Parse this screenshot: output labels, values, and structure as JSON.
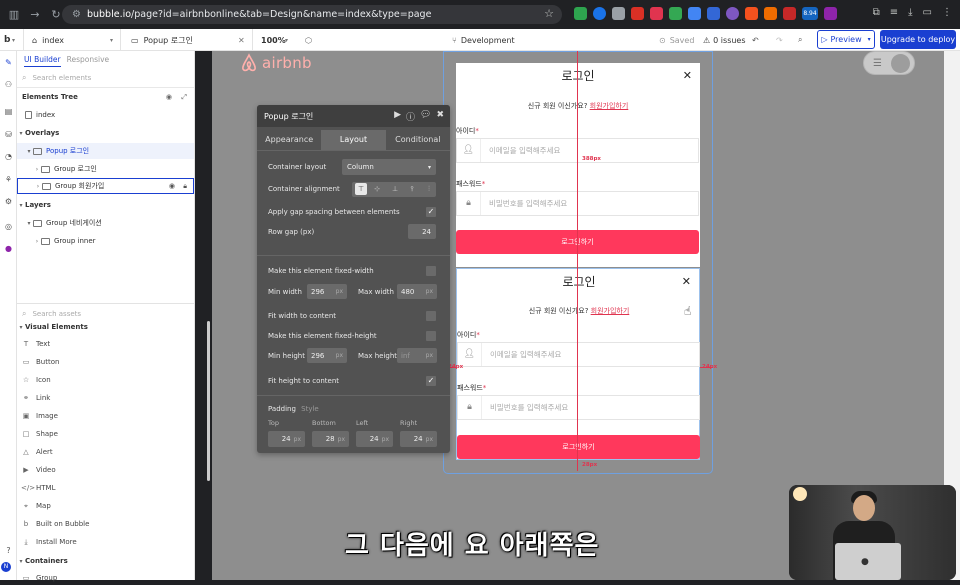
{
  "browser": {
    "url_host": "bubble.io",
    "url_path": "/page?id=airbnbonline&tab=Design&name=index&type=page",
    "badge": "8.94"
  },
  "topbar": {
    "logo": "b",
    "page_name": "index",
    "element_name": "Popup 로그인",
    "zoom": "100%",
    "branch": "Development",
    "saved": "Saved",
    "issues": "0 issues",
    "preview": "Preview",
    "deploy": "Upgrade to deploy"
  },
  "panel": {
    "tab_builder": "UI Builder",
    "tab_responsive": "Responsive",
    "search_elements": "Search elements",
    "tree_title": "Elements Tree",
    "tree": [
      {
        "label": "index",
        "indent": 0
      },
      {
        "label": "Overlays",
        "indent": 0
      },
      {
        "label": "Popup 로그인",
        "indent": 1
      },
      {
        "label": "Group 로그인",
        "indent": 2
      },
      {
        "label": "Group 회원가입",
        "indent": 2
      },
      {
        "label": "Layers",
        "indent": 0
      },
      {
        "label": "Group 네비게이션",
        "indent": 1
      },
      {
        "label": "Group inner",
        "indent": 2
      }
    ],
    "search_assets": "Search assets",
    "visual_elements": "Visual Elements",
    "assets": [
      "Text",
      "Button",
      "Icon",
      "Link",
      "Image",
      "Shape",
      "Alert",
      "Video",
      "HTML",
      "Map",
      "Built on Bubble",
      "Install More"
    ],
    "containers": "Containers",
    "containers_first": "Group"
  },
  "palette": {
    "title": "Popup 로그인",
    "tabs": [
      "Appearance",
      "Layout",
      "Conditional"
    ],
    "container_layout_label": "Container layout",
    "container_layout_value": "Column",
    "container_alignment_label": "Container alignment",
    "gap_spacing_label": "Apply gap spacing between elements",
    "row_gap_label": "Row gap (px)",
    "row_gap_value": "24",
    "fixed_width_label": "Make this element fixed-width",
    "min_width_label": "Min width",
    "min_width_value": "296",
    "min_width_unit": "px",
    "max_width_label": "Max width",
    "max_width_value": "480",
    "max_width_unit": "px",
    "fit_width_label": "Fit width to content",
    "fixed_height_label": "Make this element fixed-height",
    "min_height_label": "Min height",
    "min_height_value": "296",
    "min_height_unit": "px",
    "max_height_label": "Max height",
    "max_height_value": "inf",
    "max_height_unit": "px",
    "fit_height_label": "Fit height to content",
    "padding_label": "Padding",
    "padding_style": "Style",
    "pad_top_label": "Top",
    "pad_bottom_label": "Bottom",
    "pad_left_label": "Left",
    "pad_right_label": "Right",
    "pad_top": "24",
    "pad_bottom": "28",
    "pad_left": "24",
    "pad_right": "24",
    "pad_unit": "px"
  },
  "canvas": {
    "logo_text": "airbnb",
    "card_title": "로그인",
    "card_close": "✕",
    "card_sub": "신규 회원 이신가요?",
    "card_link": "회원가입하기",
    "id_label": "아이디",
    "id_placeholder": "이메일을 입력해주세요",
    "pw_label": "패스워드",
    "pw_placeholder": "비밀번호를 입력해주세요",
    "login_button": "로그인하기",
    "guide_388": "388px",
    "guide_24": "24px",
    "guide_24b": "24px",
    "guide_28": "28px",
    "required": "*"
  },
  "subtitle": "그 다음에 요 아래쪽은"
}
